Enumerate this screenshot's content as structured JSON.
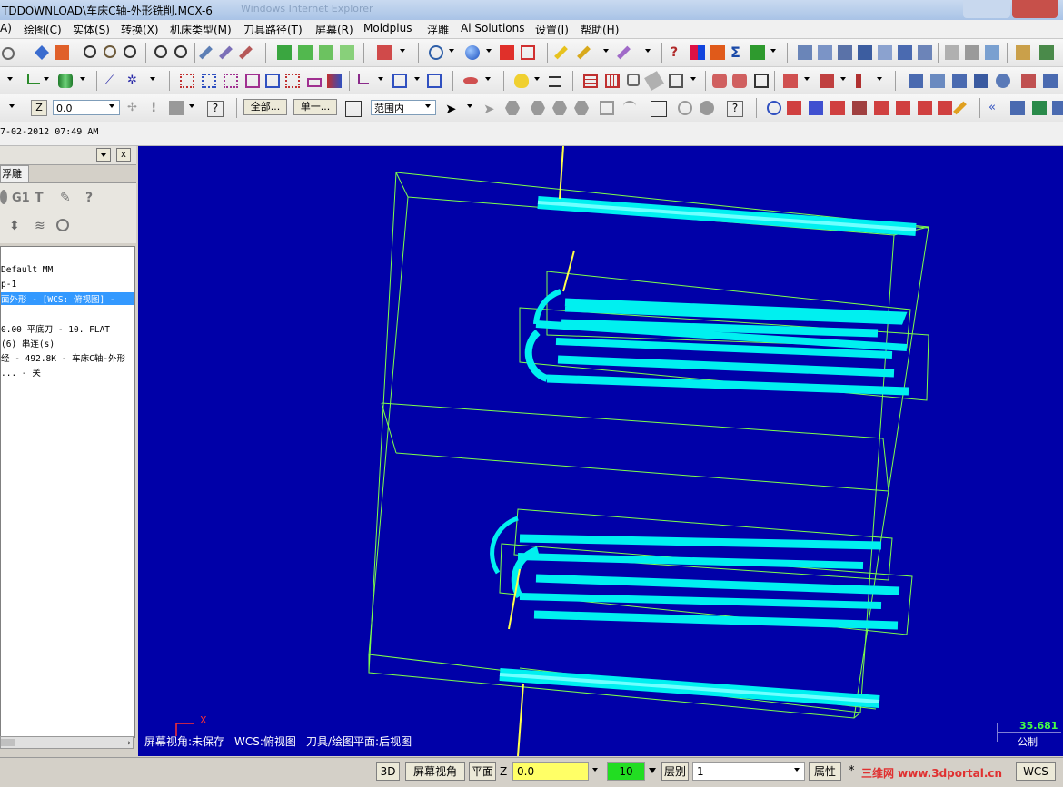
{
  "window": {
    "title": "TDDOWNLOAD\\车床C轴-外形铣削.MCX-6",
    "ghost_title": "Windows Internet Explorer"
  },
  "menu": {
    "items": [
      "A)",
      "绘图(C)",
      "实体(S)",
      "转换(X)",
      "机床类型(M)",
      "刀具路径(T)",
      "屏幕(R)",
      "Moldplus",
      "浮雕",
      "Ai Solutions",
      "设置(I)",
      "帮助(H)"
    ]
  },
  "toolbar3": {
    "z_label": "Z",
    "z_value": "0.0",
    "all_btn": "全部...",
    "single_btn": "单一...",
    "range_select": "范围内"
  },
  "datebar": {
    "date": "7-02-2012 07:49 AM"
  },
  "left_panel": {
    "tab": "浮雕",
    "g1": "G1",
    "tree": [
      "Default MM",
      "p-1",
      "面外形 - [WCS: 俯视图] -",
      "",
      "0.00 平底刀 -  10. FLAT",
      "(6) 串连(s)",
      "经 - 492.8K - 车床C轴-外形",
      "... - 关"
    ],
    "selected_index": 2
  },
  "viewport": {
    "status_text": "屏幕视角:未保存",
    "wcs_text": "WCS:俯视图",
    "plane_text": "刀具/绘图平面:后视图",
    "axis_label": "X",
    "scale_value": "35.681",
    "unit": "公制",
    "colors": {
      "background": "#0000a8",
      "wire": "#7dff4a",
      "toolpath": "#00f0f0",
      "axis": "#ffff4a"
    }
  },
  "statusbar": {
    "btn_3d": "3D",
    "btn_view": "屏幕视角",
    "btn_plane": "平面",
    "z_label": "Z",
    "z_value": "0.0",
    "color_value": "10",
    "layer_label": "层别",
    "layer_value": "1",
    "attr_label": "属性",
    "star": "*",
    "wcs": "WCS",
    "watermark": "三维网 www.3dportal.cn"
  }
}
